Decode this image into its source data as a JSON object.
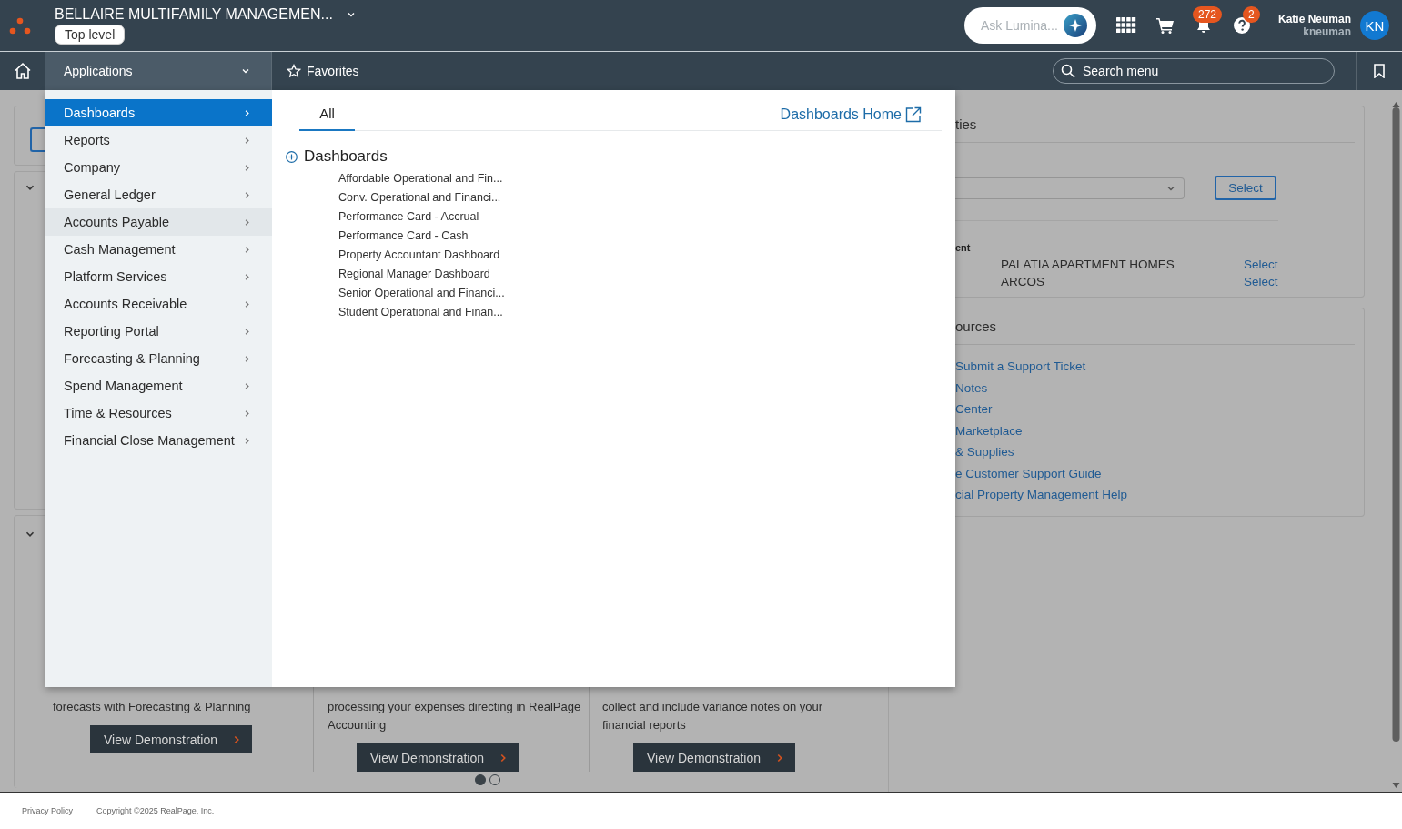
{
  "header": {
    "title": "BELLAIRE MULTIFAMILY MANAGEMEN...",
    "level_badge": "Top level",
    "assistant": {
      "placeholder": "Ask Lumina..."
    },
    "notifications": {
      "count": "272"
    },
    "help": {
      "count": "2"
    },
    "user": {
      "name": "Katie Neuman",
      "username": "kneuman",
      "initials": "KN"
    }
  },
  "nav": {
    "tabs": [
      {
        "label": "Applications",
        "selected": true
      },
      {
        "label": "Favorites",
        "selected": false
      }
    ],
    "search": {
      "placeholder": "Search menu"
    }
  },
  "menu": {
    "categories": [
      {
        "label": "Dashboards",
        "selected": true,
        "hovered": false
      },
      {
        "label": "Reports",
        "selected": false,
        "hovered": false
      },
      {
        "label": "Company",
        "selected": false,
        "hovered": false
      },
      {
        "label": "General Ledger",
        "selected": false,
        "hovered": false
      },
      {
        "label": "Accounts Payable",
        "selected": false,
        "hovered": true
      },
      {
        "label": "Cash Management",
        "selected": false,
        "hovered": false
      },
      {
        "label": "Platform Services",
        "selected": false,
        "hovered": false
      },
      {
        "label": "Accounts Receivable",
        "selected": false,
        "hovered": false
      },
      {
        "label": "Reporting Portal",
        "selected": false,
        "hovered": false
      },
      {
        "label": "Forecasting & Planning",
        "selected": false,
        "hovered": false
      },
      {
        "label": "Spend Management",
        "selected": false,
        "hovered": false
      },
      {
        "label": "Time & Resources",
        "selected": false,
        "hovered": false
      },
      {
        "label": "Financial Close Management",
        "selected": false,
        "hovered": false
      }
    ],
    "tabs": [
      {
        "label": "All",
        "selected": true
      }
    ],
    "home_link": "Dashboards Home",
    "section": {
      "title": "Dashboards",
      "expanded": false,
      "items": [
        "Affordable Operational and Fin...",
        "Conv. Operational and Financi...",
        "Performance Card - Accrual",
        "Performance Card - Cash",
        "Property Accountant Dashboard",
        "Regional Manager Dashboard",
        "Senior Operational and Financi...",
        "Student Operational and Finan..."
      ]
    }
  },
  "background": {
    "properties_panel": {
      "title": "ties",
      "button": "Select",
      "list_heading": "ent",
      "rows": [
        {
          "name": "PALATIA APARTMENT HOMES",
          "action": "Select"
        },
        {
          "name": "ARCOS",
          "action": "Select"
        }
      ]
    },
    "resources_panel": {
      "title": "ources",
      "links": [
        "Submit a Support Ticket",
        "Notes",
        "Center",
        "Marketplace",
        "& Supplies",
        "e Customer Support Guide",
        "cial Property Management Help"
      ]
    },
    "demos": [
      {
        "lines": [
          "forecasts with Forecasting & Planning"
        ],
        "button": "View Demonstration"
      },
      {
        "lines": [
          "processing your expenses directing in RealPage",
          "Accounting"
        ],
        "button": "View Demonstration"
      },
      {
        "lines": [
          "collect and include variance notes on your",
          "financial reports"
        ],
        "button": "View Demonstration"
      }
    ],
    "pager": [
      {
        "selected": true
      },
      {
        "selected": false
      }
    ]
  },
  "footer": {
    "links": [
      "Privacy Policy"
    ],
    "copyright": "Copyright ©2025 RealPage, Inc."
  }
}
